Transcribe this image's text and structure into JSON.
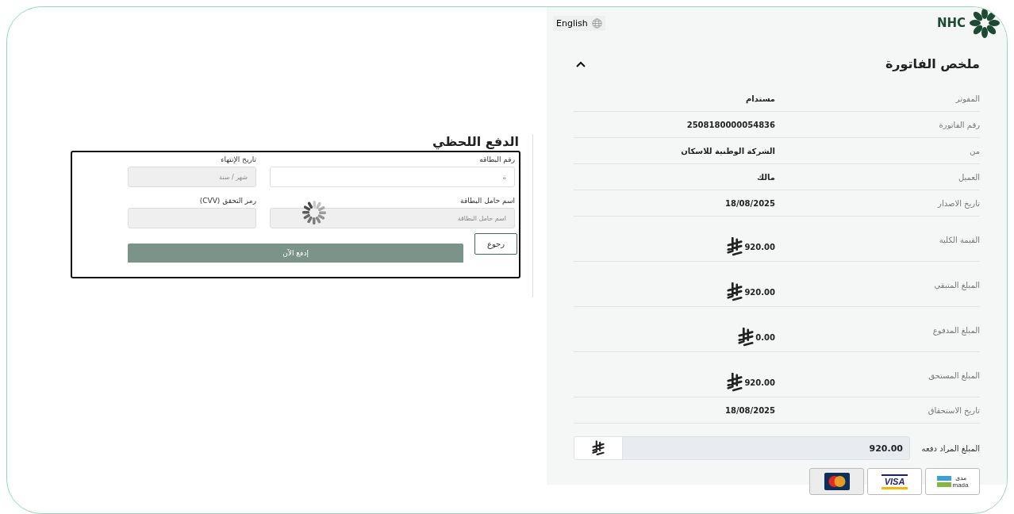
{
  "language_button": {
    "label": "English"
  },
  "logo": {
    "text": "NHC"
  },
  "invoice_summary": {
    "title": "ملخص الفاتورة",
    "expanded": true,
    "rows": [
      {
        "label": "المفوتر",
        "value": "مستدام",
        "kind": "text"
      },
      {
        "label": "رقم الفاتورة",
        "value": "2508180000054836",
        "kind": "text"
      },
      {
        "label": "من",
        "value": "الشركة الوطنية للاسكان",
        "kind": "text"
      },
      {
        "label": "العميل",
        "value": "مالك",
        "kind": "text"
      },
      {
        "label": "تاريخ الاصدار",
        "value": "18/08/2025",
        "kind": "text"
      },
      {
        "label": "القيمة الكلية",
        "value": "920.00",
        "kind": "amount"
      },
      {
        "label": "المبلغ المتبقي",
        "value": "920.00",
        "kind": "amount"
      },
      {
        "label": "المبلغ المدفوع",
        "value": "0.00",
        "kind": "amount"
      },
      {
        "label": "المبلغ المستحق",
        "value": "920.00",
        "kind": "amount"
      },
      {
        "label": "تاريخ الاستحقاق",
        "value": "18/08/2025",
        "kind": "text"
      }
    ]
  },
  "payment_amount": {
    "label": "المبلغ المراد دفعه",
    "value": "920.00"
  },
  "card_types": [
    {
      "kind": "mada",
      "texts": [
        "مدى",
        "mada"
      ],
      "selected": false
    },
    {
      "kind": "visa",
      "texts": [
        "VISA"
      ],
      "selected": false
    },
    {
      "kind": "mastercard",
      "selected": true
    }
  ],
  "instant_payment": {
    "title": "الدفع اللحظي",
    "loading": true,
    "fields": [
      {
        "label": "رقم البطاقه",
        "placeholder": "ة",
        "disabled": false
      },
      {
        "label": "تاريخ الإنتهاء",
        "placeholder": "شهر / سنة",
        "disabled": true
      },
      {
        "label": "اسم حامل البطاقة",
        "placeholder": "اسم حامل البطاقة",
        "disabled": true
      },
      {
        "label": "رمز التحقق (CVV)",
        "disabled": true
      }
    ],
    "back_button": "رجوع",
    "pay_button": "إدفع الآن"
  }
}
